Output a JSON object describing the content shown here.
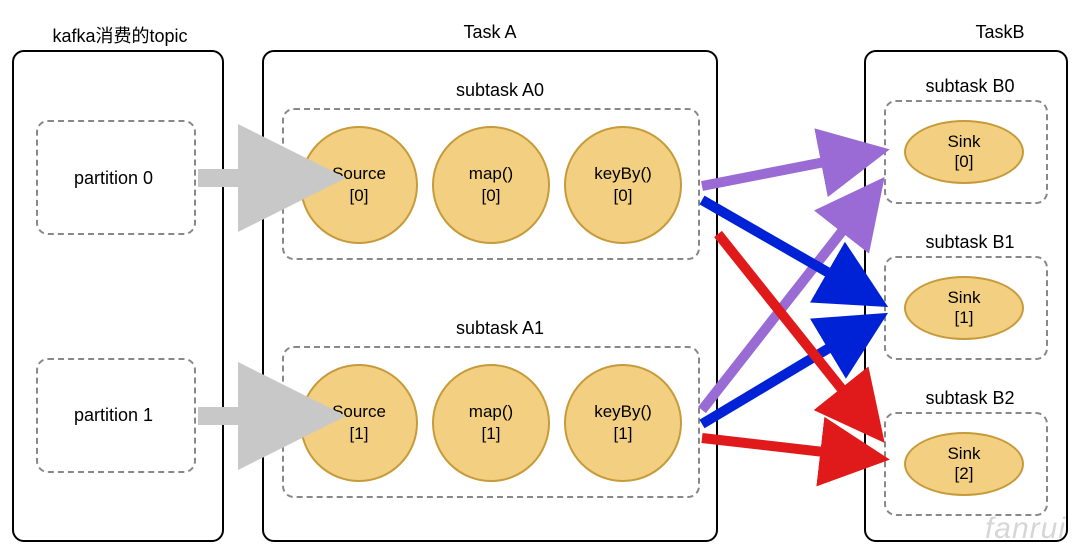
{
  "kafka": {
    "title": "kafka消费的topic",
    "partitions": [
      "partition 0",
      "partition 1"
    ]
  },
  "taskA": {
    "title": "Task A",
    "subtasks": [
      {
        "label": "subtask A0",
        "ops": [
          {
            "name": "Source",
            "idx": "[0]"
          },
          {
            "name": "map()",
            "idx": "[0]"
          },
          {
            "name": "keyBy()",
            "idx": "[0]"
          }
        ]
      },
      {
        "label": "subtask A1",
        "ops": [
          {
            "name": "Source",
            "idx": "[1]"
          },
          {
            "name": "map()",
            "idx": "[1]"
          },
          {
            "name": "keyBy()",
            "idx": "[1]"
          }
        ]
      }
    ]
  },
  "taskB": {
    "title": "TaskB",
    "subtasks": [
      {
        "label": "subtask B0",
        "sink": {
          "name": "Sink",
          "idx": "[0]"
        }
      },
      {
        "label": "subtask B1",
        "sink": {
          "name": "Sink",
          "idx": "[1]"
        }
      },
      {
        "label": "subtask B2",
        "sink": {
          "name": "Sink",
          "idx": "[2]"
        }
      }
    ]
  },
  "colors": {
    "grayArrow": "#c8c8c8",
    "purple": "#9a6bd4",
    "blue": "#0022d6",
    "red": "#e01a1a",
    "nodeFill": "#f3d081",
    "nodeStroke": "#c79a3a"
  },
  "watermark": "fanrui"
}
